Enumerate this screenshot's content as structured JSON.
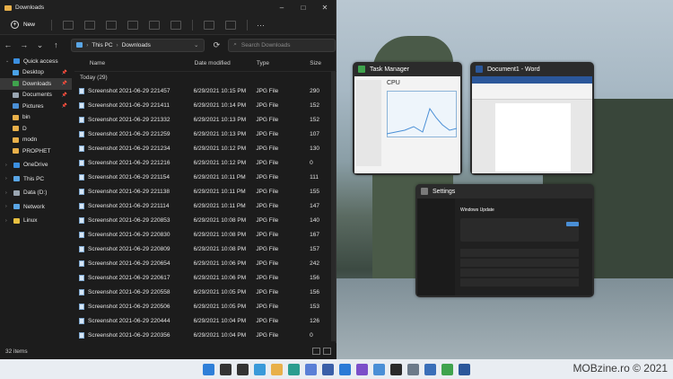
{
  "explorer": {
    "title": "Downloads",
    "new_label": "New",
    "breadcrumb": [
      "This PC",
      "Downloads"
    ],
    "search_placeholder": "Search Downloads",
    "columns": [
      "Name",
      "Date modified",
      "Type",
      "Size"
    ],
    "group_label": "Today (29)",
    "status": "32 items",
    "sidebar": [
      {
        "label": "Quick access",
        "level": 0,
        "color": "#3b8fe0"
      },
      {
        "label": "Desktop",
        "level": 1,
        "color": "#4aa3e8",
        "pin": true
      },
      {
        "label": "Downloads",
        "level": 1,
        "color": "#3fa34d",
        "pin": true,
        "selected": true
      },
      {
        "label": "Documents",
        "level": 1,
        "color": "#9aa6b2",
        "pin": true
      },
      {
        "label": "Pictures",
        "level": 1,
        "color": "#4a8fd6",
        "pin": true
      },
      {
        "label": "bin",
        "level": 1,
        "color": "#e8b04a"
      },
      {
        "label": "D",
        "level": 1,
        "color": "#e8b04a"
      },
      {
        "label": "modn",
        "level": 1,
        "color": "#e8b04a"
      },
      {
        "label": "PROPHET",
        "level": 1,
        "color": "#e8b04a"
      },
      {
        "label": "",
        "level": -1
      },
      {
        "label": "OneDrive",
        "level": 0,
        "color": "#3b8fe0"
      },
      {
        "label": "",
        "level": -1
      },
      {
        "label": "This PC",
        "level": 0,
        "color": "#5aa6e6"
      },
      {
        "label": "",
        "level": -1
      },
      {
        "label": "Data (D:)",
        "level": 0,
        "color": "#9aa6b2"
      },
      {
        "label": "",
        "level": -1
      },
      {
        "label": "Network",
        "level": 0,
        "color": "#5aa6e6"
      },
      {
        "label": "",
        "level": -1
      },
      {
        "label": "Linux",
        "level": 0,
        "color": "#e8c040"
      }
    ],
    "files": [
      {
        "name": "Screenshot 2021-06-29 221457",
        "date": "6/29/2021 10:15 PM",
        "type": "JPG File",
        "size": "290"
      },
      {
        "name": "Screenshot 2021-06-29 221411",
        "date": "6/29/2021 10:14 PM",
        "type": "JPG File",
        "size": "152"
      },
      {
        "name": "Screenshot 2021-06-29 221332",
        "date": "6/29/2021 10:13 PM",
        "type": "JPG File",
        "size": "152"
      },
      {
        "name": "Screenshot 2021-06-29 221259",
        "date": "6/29/2021 10:13 PM",
        "type": "JPG File",
        "size": "107"
      },
      {
        "name": "Screenshot 2021-06-29 221234",
        "date": "6/29/2021 10:12 PM",
        "type": "JPG File",
        "size": "130"
      },
      {
        "name": "Screenshot 2021-06-29 221216",
        "date": "6/29/2021 10:12 PM",
        "type": "JPG File",
        "size": "0"
      },
      {
        "name": "Screenshot 2021-06-29 221154",
        "date": "6/29/2021 10:11 PM",
        "type": "JPG File",
        "size": "111"
      },
      {
        "name": "Screenshot 2021-06-29 221138",
        "date": "6/29/2021 10:11 PM",
        "type": "JPG File",
        "size": "155"
      },
      {
        "name": "Screenshot 2021-06-29 221114",
        "date": "6/29/2021 10:11 PM",
        "type": "JPG File",
        "size": "147"
      },
      {
        "name": "Screenshot 2021-06-29 220853",
        "date": "6/29/2021 10:08 PM",
        "type": "JPG File",
        "size": "140"
      },
      {
        "name": "Screenshot 2021-06-29 220830",
        "date": "6/29/2021 10:08 PM",
        "type": "JPG File",
        "size": "167"
      },
      {
        "name": "Screenshot 2021-06-29 220809",
        "date": "6/29/2021 10:08 PM",
        "type": "JPG File",
        "size": "157"
      },
      {
        "name": "Screenshot 2021-06-29 220654",
        "date": "6/29/2021 10:06 PM",
        "type": "JPG File",
        "size": "242"
      },
      {
        "name": "Screenshot 2021-06-29 220617",
        "date": "6/29/2021 10:06 PM",
        "type": "JPG File",
        "size": "156"
      },
      {
        "name": "Screenshot 2021-06-29 220558",
        "date": "6/29/2021 10:05 PM",
        "type": "JPG File",
        "size": "156"
      },
      {
        "name": "Screenshot 2021-06-29 220506",
        "date": "6/29/2021 10:05 PM",
        "type": "JPG File",
        "size": "153"
      },
      {
        "name": "Screenshot 2021-06-29 220444",
        "date": "6/29/2021 10:04 PM",
        "type": "JPG File",
        "size": "126"
      },
      {
        "name": "Screenshot 2021-06-29 220356",
        "date": "6/29/2021 10:04 PM",
        "type": "JPG File",
        "size": "0"
      }
    ]
  },
  "snap": {
    "task_manager": {
      "title": "Task Manager",
      "heading": "CPU",
      "icon_color": "#3fa34d"
    },
    "word": {
      "title": "Document1 - Word",
      "icon_color": "#2b579a"
    },
    "settings": {
      "title": "Settings",
      "heading": "Windows Update",
      "icon_color": "#7a7a7a"
    }
  },
  "taskbar": {
    "icons": [
      {
        "name": "start-icon",
        "color": "#2f7fd8"
      },
      {
        "name": "search-icon",
        "color": "#333333"
      },
      {
        "name": "task-view-icon",
        "color": "#333333"
      },
      {
        "name": "widgets-icon",
        "color": "#3a9ad9"
      },
      {
        "name": "file-explorer-icon",
        "color": "#e8b04a"
      },
      {
        "name": "edge-icon",
        "color": "#2a9d8f"
      },
      {
        "name": "store-icon",
        "color": "#5a7fd6"
      },
      {
        "name": "floppy-app-icon",
        "color": "#3a5fa8"
      },
      {
        "name": "vs-code-icon",
        "color": "#2a7ad6"
      },
      {
        "name": "visual-studio-icon",
        "color": "#7b4fc9"
      },
      {
        "name": "photos-icon",
        "color": "#4a8fd6"
      },
      {
        "name": "terminal-icon",
        "color": "#2a2a2a"
      },
      {
        "name": "settings-gear-icon",
        "color": "#6c7a89"
      },
      {
        "name": "snip-icon",
        "color": "#3a6fb8"
      },
      {
        "name": "task-manager-icon",
        "color": "#3fa34d"
      },
      {
        "name": "word-icon",
        "color": "#2b579a"
      }
    ],
    "watermark": "MOBzine.ro © 2021"
  }
}
